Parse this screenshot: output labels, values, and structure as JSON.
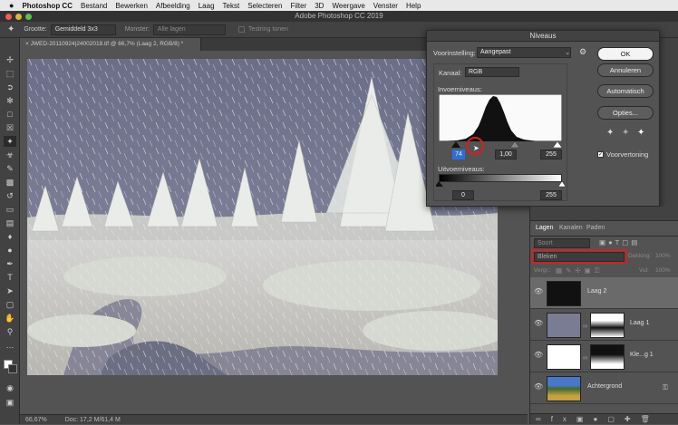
{
  "menubar": {
    "apple": "",
    "app": "Photoshop CC",
    "items": [
      "Bestand",
      "Bewerken",
      "Afbeelding",
      "Laag",
      "Tekst",
      "Selecteren",
      "Filter",
      "3D",
      "Weergave",
      "Venster",
      "Help"
    ]
  },
  "window": {
    "title": "Adobe Photoshop CC 2019"
  },
  "options": {
    "size_label": "Grootte:",
    "size_value": "Gemiddeld 3x3",
    "sample_label": "Monster:",
    "sample_value": "Alle lagen",
    "ring_label": "Testring tonen"
  },
  "document": {
    "tab": "JWED-20110924|24002018.tif @ 66,7% (Laag 2, RGB/8) *",
    "zoom": "66,67%",
    "doc_size": "Doc: 17,2 M/61,4 M"
  },
  "levels": {
    "title": "Niveaus",
    "preset_label": "Voorinstelling:",
    "preset_value": "Aangepast",
    "channel_label": "Kanaal:",
    "channel_value": "RGB",
    "input_label": "Invoerniveaus:",
    "input_black": "74",
    "input_mid": "1,00",
    "input_white": "255",
    "output_label": "Uitvoerniveaus:",
    "output_black": "0",
    "output_white": "255",
    "btn_ok": "OK",
    "btn_cancel": "Annuleren",
    "btn_auto": "Automatisch",
    "btn_options": "Opties...",
    "preview_label": "Voorvertoning"
  },
  "panels": {
    "tabs": [
      "Lagen",
      "Kanalen",
      "Paden"
    ],
    "filter_placeholder": "Soort",
    "blend_mode": "Bleken",
    "opacity_label": "Dekking:",
    "opacity_value": "100%",
    "lock_label": "Vergr.:",
    "fill_label": "Vul:",
    "fill_value": "100%"
  },
  "layers": [
    {
      "name": "Laag 2"
    },
    {
      "name": "Laag 1"
    },
    {
      "name": "Kle...g 1"
    },
    {
      "name": "Achtergrond"
    }
  ],
  "colors": {
    "accent": "#2d6fd6",
    "highlight": "#d42020"
  }
}
